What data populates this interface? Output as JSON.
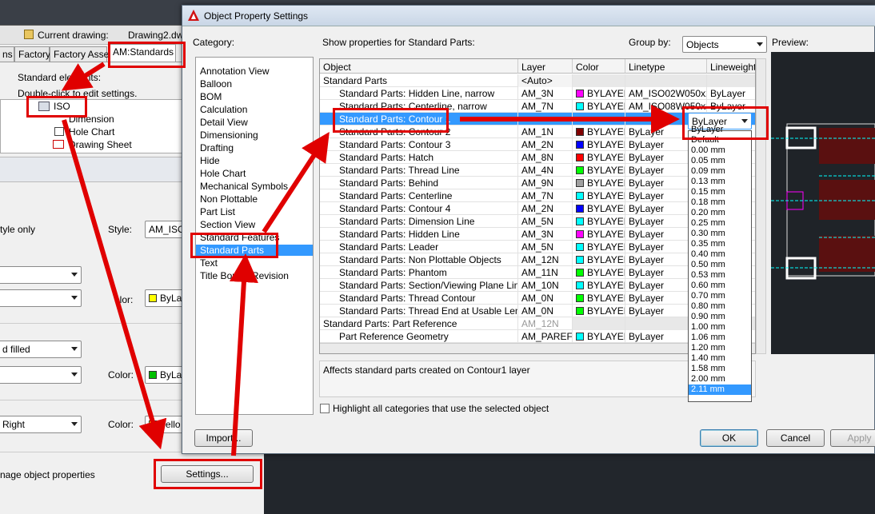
{
  "background": {
    "current_drawing_label": "Current drawing:",
    "drawing_name": "Drawing2.dwg",
    "tabs": [
      "ns",
      "Factory",
      "Factory Assets",
      "AM:Standards"
    ],
    "standard_elements_label": "Standard elements:",
    "double_click_hint": "Double-click to edit settings.",
    "tree": [
      "ISO",
      "Dimension",
      "Hole Chart",
      "Drawing Sheet"
    ],
    "style_only": "tyle only",
    "style_label": "Style:",
    "style_value": "AM_ISO",
    "color_label_1": "olor:",
    "color_value_1": "ByLa",
    "fill_combo": "d filled",
    "color_label_2": "Color:",
    "color_value_2": "ByLa",
    "right_combo": "Right",
    "color_label_3": "Color:",
    "color_value_3": "Yello",
    "manage_text": "nage object properties",
    "settings_button": "Settings..."
  },
  "dialog": {
    "title": "Object Property Settings",
    "category_label": "Category:",
    "show_props_label": "Show properties for Standard Parts:",
    "group_by_label": "Group by:",
    "group_by_value": "Objects",
    "preview_label": "Preview:",
    "categories": [
      "Annotation View",
      "Balloon",
      "BOM",
      "Calculation",
      "Detail View",
      "Dimensioning",
      "Drafting",
      "Hide",
      "Hole Chart",
      "Mechanical Symbols",
      "Non Plottable",
      "Part List",
      "Section View",
      "Standard Features",
      "Standard Parts",
      "Text",
      "Title Border/Revision"
    ],
    "selected_category": "Standard Parts",
    "columns": [
      "Object",
      "Layer",
      "Color",
      "Linetype",
      "Lineweight"
    ],
    "rows": [
      {
        "object": "Standard Parts",
        "layer": "<Auto>",
        "color": "",
        "ctext": "",
        "linetype": "",
        "lineweight": "",
        "group": true
      },
      {
        "object": "Standard Parts: Hidden Line, narrow",
        "layer": "AM_3N",
        "color": "#ff00ff",
        "ctext": "BYLAYER",
        "linetype": "AM_ISO02W050x2",
        "lineweight": "ByLayer"
      },
      {
        "object": "Standard Parts: Centerline, narrow",
        "layer": "AM_7N",
        "color": "#00ffff",
        "ctext": "BYLAYER",
        "linetype": "AM_ISO08W050x2",
        "lineweight": "ByLayer"
      },
      {
        "object": "Standard Parts: Contour 1",
        "layer": "",
        "color": "",
        "ctext": "",
        "linetype": "",
        "lineweight": "",
        "selected": true
      },
      {
        "object": "Standard Parts: Contour 2",
        "layer": "AM_1N",
        "color": "#800000",
        "ctext": "BYLAYER",
        "linetype": "ByLayer",
        "lineweight": ""
      },
      {
        "object": "Standard Parts: Contour 3",
        "layer": "AM_2N",
        "color": "#0000ff",
        "ctext": "BYLAYER",
        "linetype": "ByLayer",
        "lineweight": ""
      },
      {
        "object": "Standard Parts: Hatch",
        "layer": "AM_8N",
        "color": "#ff0000",
        "ctext": "BYLAYER",
        "linetype": "ByLayer",
        "lineweight": ""
      },
      {
        "object": "Standard Parts: Thread Line",
        "layer": "AM_4N",
        "color": "#00ff00",
        "ctext": "BYLAYER",
        "linetype": "ByLayer",
        "lineweight": ""
      },
      {
        "object": "Standard Parts: Behind",
        "layer": "AM_9N",
        "color": "#a0a0a0",
        "ctext": "BYLAYER",
        "linetype": "ByLayer",
        "lineweight": ""
      },
      {
        "object": "Standard Parts: Centerline",
        "layer": "AM_7N",
        "color": "#00ffff",
        "ctext": "BYLAYER",
        "linetype": "ByLayer",
        "lineweight": ""
      },
      {
        "object": "Standard Parts: Contour 4",
        "layer": "AM_2N",
        "color": "#0000ff",
        "ctext": "BYLAYER",
        "linetype": "ByLayer",
        "lineweight": ""
      },
      {
        "object": "Standard Parts: Dimension Line",
        "layer": "AM_5N",
        "color": "#00ffff",
        "ctext": "BYLAYER",
        "linetype": "ByLayer",
        "lineweight": ""
      },
      {
        "object": "Standard Parts: Hidden Line",
        "layer": "AM_3N",
        "color": "#ff00ff",
        "ctext": "BYLAYER",
        "linetype": "ByLayer",
        "lineweight": ""
      },
      {
        "object": "Standard Parts: Leader",
        "layer": "AM_5N",
        "color": "#00ffff",
        "ctext": "BYLAYER",
        "linetype": "ByLayer",
        "lineweight": ""
      },
      {
        "object": "Standard Parts: Non Plottable Objects",
        "layer": "AM_12N",
        "color": "#00ffff",
        "ctext": "BYLAYER",
        "linetype": "ByLayer",
        "lineweight": ""
      },
      {
        "object": "Standard Parts: Phantom",
        "layer": "AM_11N",
        "color": "#00ff00",
        "ctext": "BYLAYER",
        "linetype": "ByLayer",
        "lineweight": ""
      },
      {
        "object": "Standard Parts: Section/Viewing Plane Line",
        "layer": "AM_10N",
        "color": "#00ffff",
        "ctext": "BYLAYER",
        "linetype": "ByLayer",
        "lineweight": ""
      },
      {
        "object": "Standard Parts: Thread Contour",
        "layer": "AM_0N",
        "color": "#00ff00",
        "ctext": "BYLAYER",
        "linetype": "ByLayer",
        "lineweight": ""
      },
      {
        "object": "Standard Parts: Thread End at Usable Length",
        "layer": "AM_0N",
        "color": "#00ff00",
        "ctext": "BYLAYER",
        "linetype": "ByLayer",
        "lineweight": ""
      },
      {
        "object": "Standard Parts: Part Reference",
        "layer": "AM_12N",
        "color": "",
        "ctext": "",
        "linetype": "",
        "lineweight": "",
        "group": true,
        "ghost": true
      },
      {
        "object": "Part Reference Geometry",
        "layer": "AM_PAREF",
        "color": "#00ffff",
        "ctext": "BYLAYER",
        "linetype": "ByLayer",
        "lineweight": ""
      }
    ],
    "lineweight_combo": "ByLayer",
    "lineweight_options": [
      "ByLayer",
      "Default",
      "0.00 mm",
      "0.05 mm",
      "0.09 mm",
      "0.13 mm",
      "0.15 mm",
      "0.18 mm",
      "0.20 mm",
      "0.25 mm",
      "0.30 mm",
      "0.35 mm",
      "0.40 mm",
      "0.50 mm",
      "0.53 mm",
      "0.60 mm",
      "0.70 mm",
      "0.80 mm",
      "0.90 mm",
      "1.00 mm",
      "1.06 mm",
      "1.20 mm",
      "1.40 mm",
      "1.58 mm",
      "2.00 mm",
      "2.11 mm"
    ],
    "highlighted_option": "2.11 mm",
    "description": "Affects standard parts created on Contour1 layer",
    "highlight_checkbox": "Highlight all categories that use the selected object",
    "import_button": "Import...",
    "ok_button": "OK",
    "cancel_button": "Cancel",
    "apply_button": "Apply"
  },
  "colors": {
    "annotation_red": "#e00000",
    "selection_blue": "#3399ff"
  }
}
